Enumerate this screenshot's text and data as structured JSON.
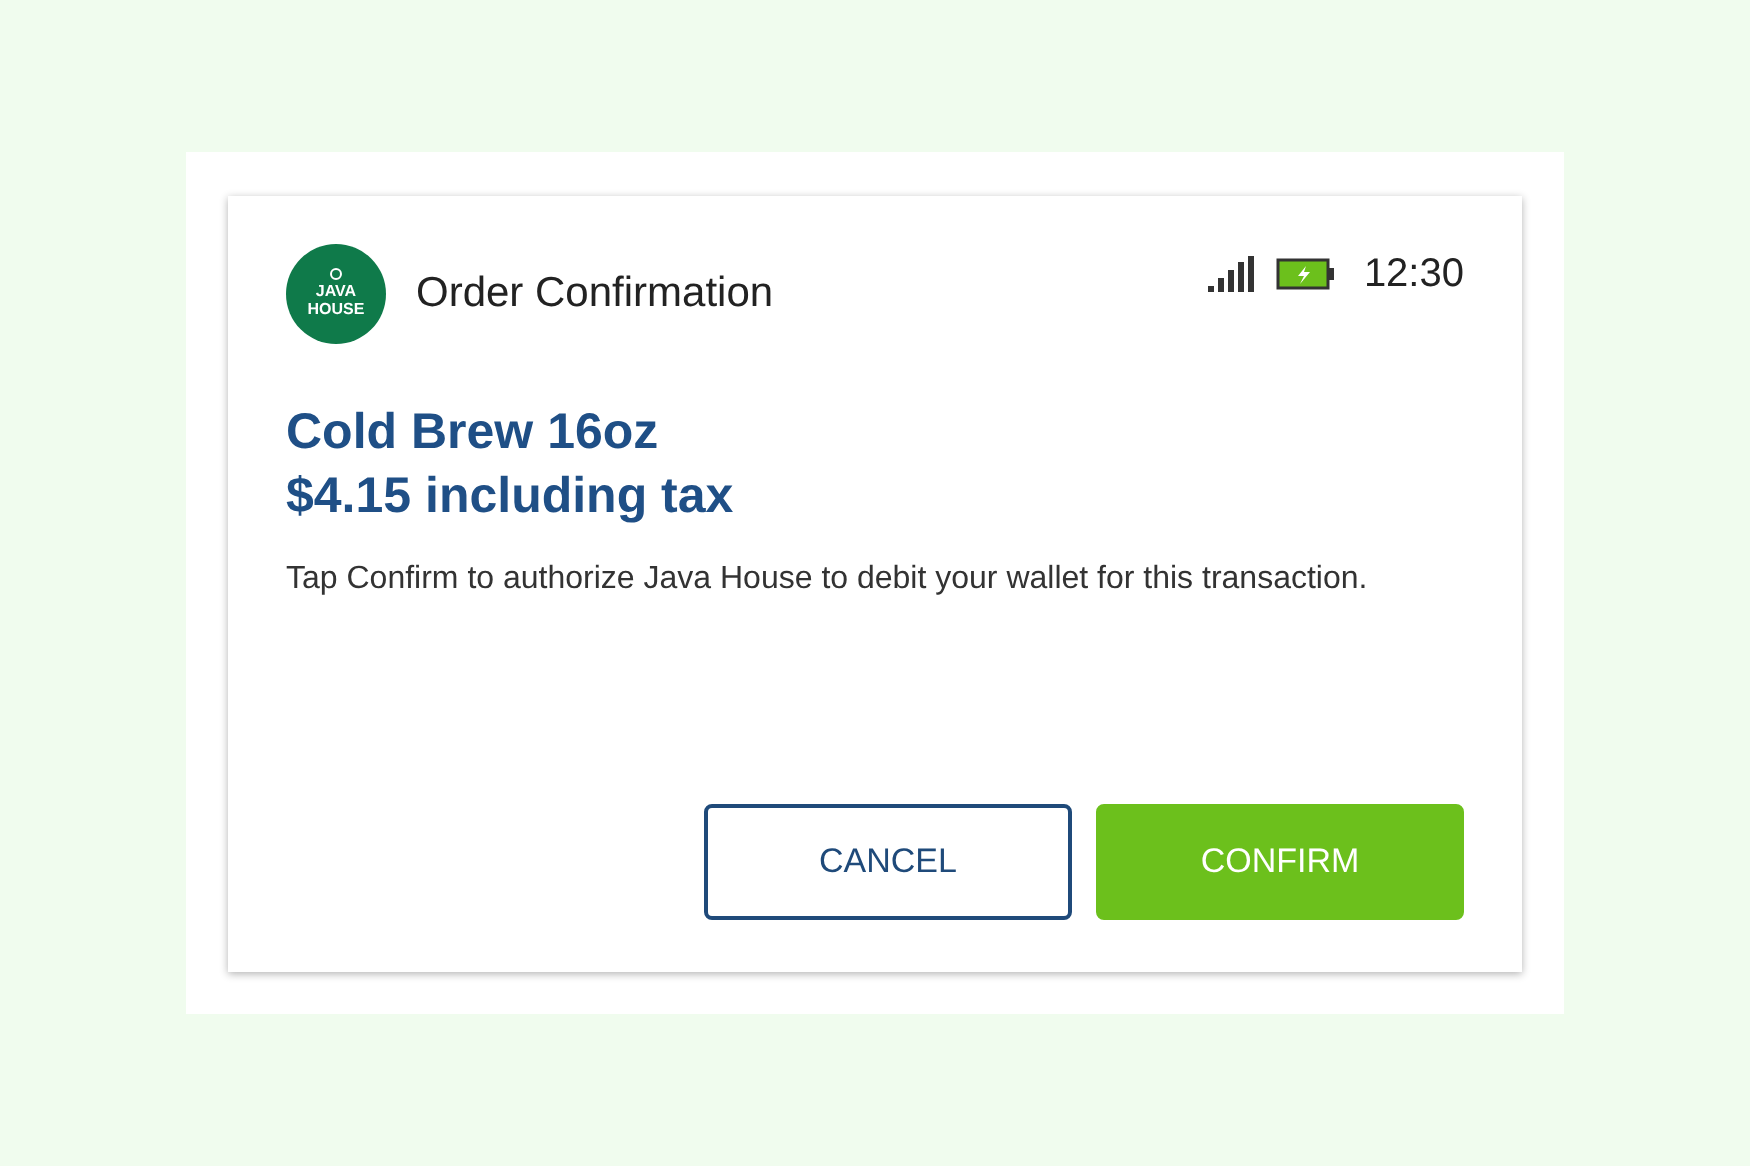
{
  "logo": {
    "lines": [
      "JAVA",
      "HOUSE"
    ]
  },
  "header": {
    "title": "Order Confirmation",
    "time": "12:30"
  },
  "order": {
    "item": "Cold Brew 16oz",
    "price": "$4.15 including tax",
    "message": "Tap Confirm to authorize Java House to debit your wallet for this transaction."
  },
  "buttons": [
    {
      "label": "CANCEL",
      "kind": "secondary"
    },
    {
      "label": "CONFIRM",
      "kind": "primary"
    }
  ]
}
